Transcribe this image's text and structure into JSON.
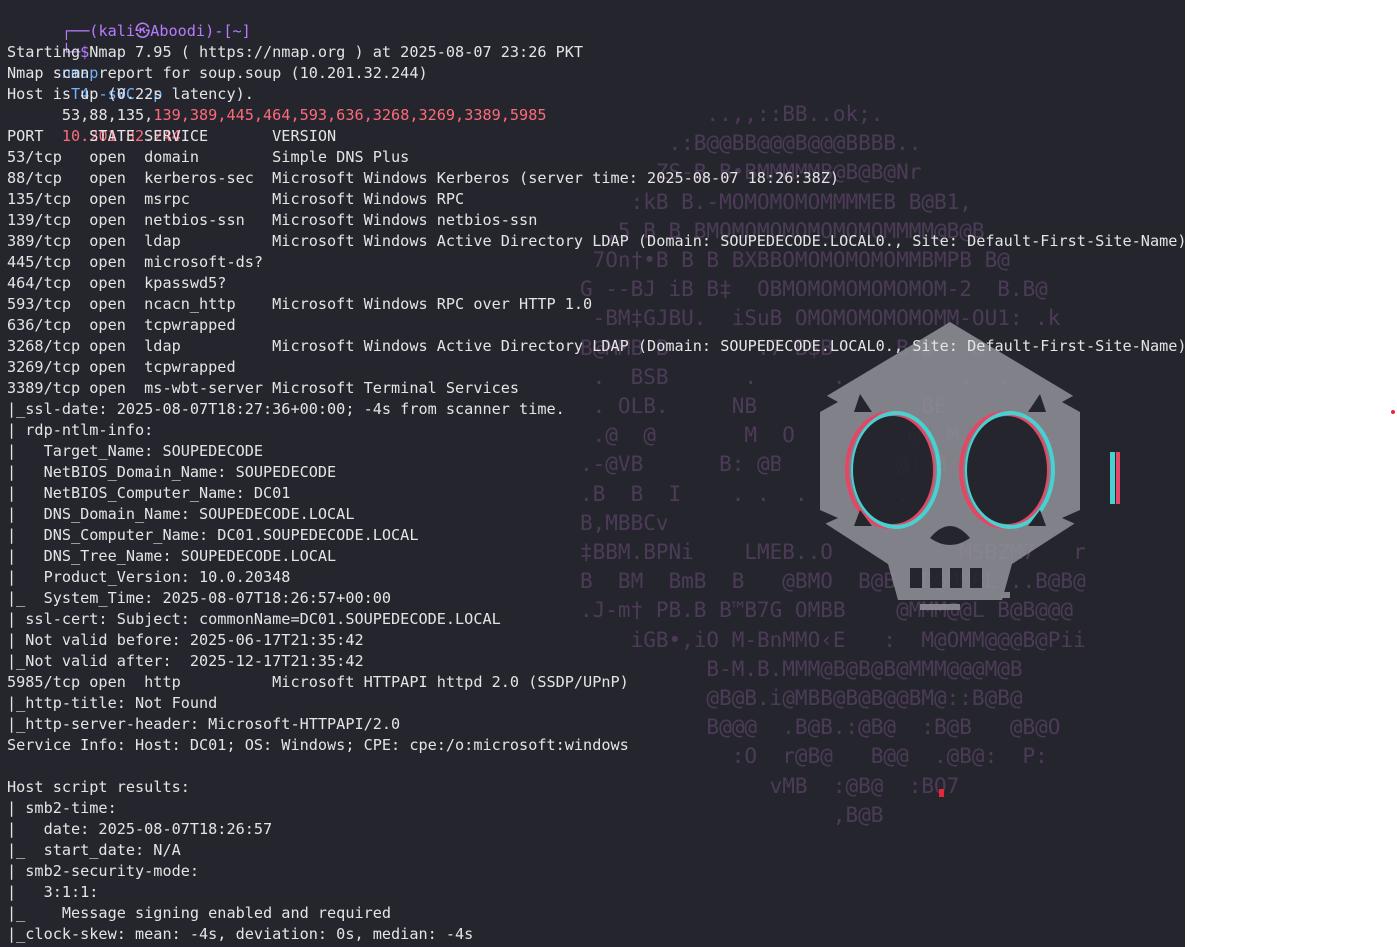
{
  "prompt": {
    "top_line": "┌──(kali㉿Aboodi)-[~]",
    "prompt_symbol": "└─$",
    "command_name": "nmap",
    "flags": "-T4 -sVC -p",
    "ports_plain": "53,88,135,",
    "ports_highlight": "139,389,445,464,593,636,3268,3269,3389,5985",
    "target_ip": "10.201.32.244"
  },
  "output_lines": [
    "Starting Nmap 7.95 ( https://nmap.org ) at 2025-08-07 23:26 PKT",
    "Nmap scan report for soup.soup (10.201.32.244)",
    "Host is up (0.22s latency).",
    "",
    "PORT     STATE SERVICE       VERSION",
    "53/tcp   open  domain        Simple DNS Plus",
    "88/tcp   open  kerberos-sec  Microsoft Windows Kerberos (server time: 2025-08-07 18:26:38Z)",
    "135/tcp  open  msrpc         Microsoft Windows RPC",
    "139/tcp  open  netbios-ssn   Microsoft Windows netbios-ssn",
    "389/tcp  open  ldap          Microsoft Windows Active Directory LDAP (Domain: SOUPEDECODE.LOCAL0., Site: Default-First-Site-Name)",
    "445/tcp  open  microsoft-ds?",
    "464/tcp  open  kpasswd5?",
    "593/tcp  open  ncacn_http    Microsoft Windows RPC over HTTP 1.0",
    "636/tcp  open  tcpwrapped",
    "3268/tcp open  ldap          Microsoft Windows Active Directory LDAP (Domain: SOUPEDECODE.LOCAL0., Site: Default-First-Site-Name)",
    "3269/tcp open  tcpwrapped",
    "3389/tcp open  ms-wbt-server Microsoft Terminal Services",
    "|_ssl-date: 2025-08-07T18:27:36+00:00; -4s from scanner time.",
    "| rdp-ntlm-info:",
    "|   Target_Name: SOUPEDECODE",
    "|   NetBIOS_Domain_Name: SOUPEDECODE",
    "|   NetBIOS_Computer_Name: DC01",
    "|   DNS_Domain_Name: SOUPEDECODE.LOCAL",
    "|   DNS_Computer_Name: DC01.SOUPEDECODE.LOCAL",
    "|   DNS_Tree_Name: SOUPEDECODE.LOCAL",
    "|   Product_Version: 10.0.20348",
    "|_  System_Time: 2025-08-07T18:26:57+00:00",
    "| ssl-cert: Subject: commonName=DC01.SOUPEDECODE.LOCAL",
    "| Not valid before: 2025-06-17T21:35:42",
    "|_Not valid after:  2025-12-17T21:35:42",
    "5985/tcp open  http          Microsoft HTTPAPI httpd 2.0 (SSDP/UPnP)",
    "|_http-title: Not Found",
    "|_http-server-header: Microsoft-HTTPAPI/2.0",
    "Service Info: Host: DC01; OS: Windows; CPE: cpe:/o:microsoft:windows",
    "",
    "Host script results:",
    "| smb2-time:",
    "|   date: 2025-08-07T18:26:57",
    "|_  start_date: N/A",
    "| smb2-security-mode:",
    "|   3:1:1:",
    "|_    Message signing enabled and required",
    "|_clock-skew: mean: -4s, deviation: 0s, median: -4s"
  ],
  "colors": {
    "terminal_bg": "#25262d",
    "text": "#e4e4e4",
    "prompt": "#b77bff",
    "command": "#70b4ff",
    "highlight": "#ff6a7a",
    "art": "#5a4266",
    "skull": "#8e8f96"
  },
  "background_icon": "skull-icon"
}
